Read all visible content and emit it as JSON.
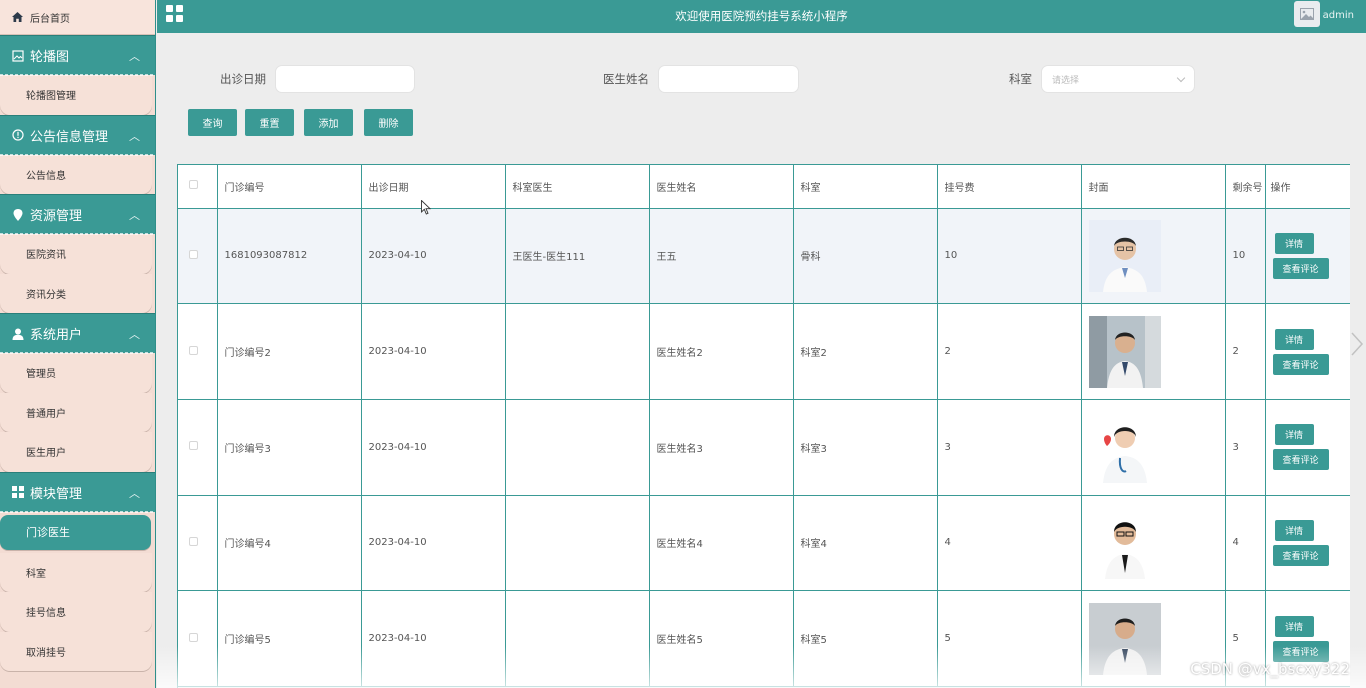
{
  "app": {
    "title": "欢迎使用医院预约挂号系统小程序",
    "username": "admin",
    "accent_color": "#3a9a95",
    "sidebar_bg": "#f3dcd3"
  },
  "sidebar": {
    "home": {
      "label": "后台首页",
      "icon": "home-icon"
    },
    "groups": [
      {
        "label": "轮播图",
        "icon": "image-icon",
        "items": [
          "轮播图管理"
        ]
      },
      {
        "label": "公告信息管理",
        "icon": "info-icon",
        "items": [
          "公告信息"
        ]
      },
      {
        "label": "资源管理",
        "icon": "location-icon",
        "items": [
          "医院资讯",
          "资讯分类"
        ]
      },
      {
        "label": "系统用户",
        "icon": "user-icon",
        "items": [
          "管理员",
          "普通用户",
          "医生用户"
        ]
      },
      {
        "label": "模块管理",
        "icon": "grid-icon",
        "items": [
          "门诊医生",
          "科室",
          "挂号信息",
          "取消挂号"
        ]
      }
    ],
    "active_item": "门诊医生"
  },
  "search": {
    "date_label": "出诊日期",
    "date_value": "",
    "doctor_label": "医生姓名",
    "doctor_value": "",
    "dept_label": "科室",
    "dept_placeholder": "请选择"
  },
  "buttons": {
    "query": "查询",
    "reset": "重置",
    "add": "添加",
    "delete": "删除"
  },
  "table": {
    "headers": [
      "门诊编号",
      "出诊日期",
      "科室医生",
      "医生姓名",
      "科室",
      "挂号费",
      "封面",
      "剩余号",
      "操作"
    ],
    "detail_label": "详情",
    "review_label": "查看评论",
    "rows": [
      {
        "id": "1681093087812",
        "date": "2023-04-10",
        "dept_doctor": "王医生-医生111",
        "doctor": "王五",
        "dept": "骨科",
        "fee": "10",
        "remaining": "10"
      },
      {
        "id": "门诊编号2",
        "date": "2023-04-10",
        "dept_doctor": "",
        "doctor": "医生姓名2",
        "dept": "科室2",
        "fee": "2",
        "remaining": "2"
      },
      {
        "id": "门诊编号3",
        "date": "2023-04-10",
        "dept_doctor": "",
        "doctor": "医生姓名3",
        "dept": "科室3",
        "fee": "3",
        "remaining": "3"
      },
      {
        "id": "门诊编号4",
        "date": "2023-04-10",
        "dept_doctor": "",
        "doctor": "医生姓名4",
        "dept": "科室4",
        "fee": "4",
        "remaining": "4"
      },
      {
        "id": "门诊编号5",
        "date": "2023-04-10",
        "dept_doctor": "",
        "doctor": "医生姓名5",
        "dept": "科室5",
        "fee": "5",
        "remaining": "5"
      }
    ]
  },
  "watermark": "CSDN @vx_bscxy322"
}
